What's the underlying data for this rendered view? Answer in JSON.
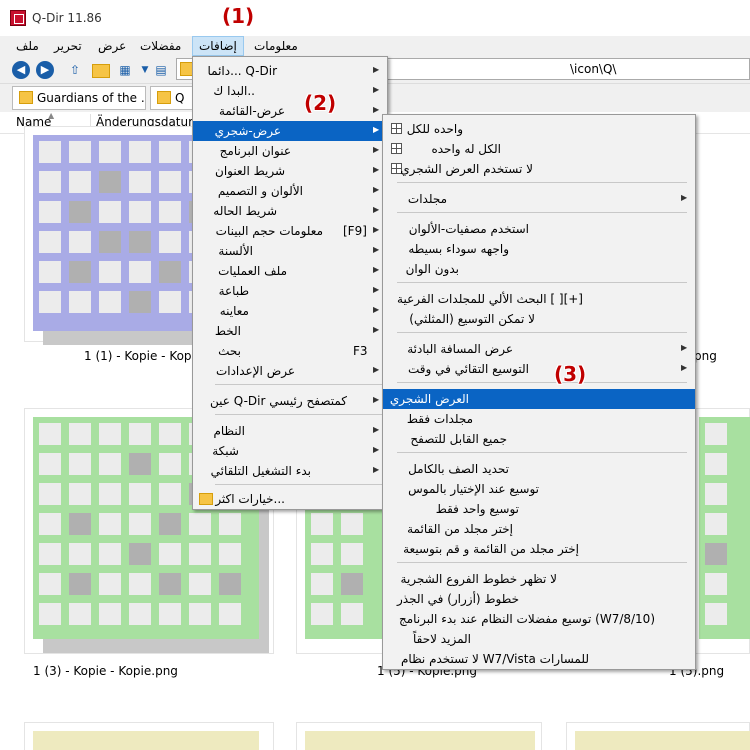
{
  "window": {
    "title": "Q-Dir 11.86"
  },
  "menubar": [
    {
      "label": "ملف"
    },
    {
      "label": "تحرير"
    },
    {
      "label": "عرض"
    },
    {
      "label": "مفضلات"
    },
    {
      "label": "إضافات"
    },
    {
      "label": "معلومات"
    }
  ],
  "address": {
    "path": "\\icon\\Q\\"
  },
  "tabs": [
    {
      "label": "Guardians of the ..."
    },
    {
      "label": "Q"
    }
  ],
  "columns": {
    "name": "Name",
    "modified": "Änderungsdatum"
  },
  "files": [
    {
      "label": "1 (1) - Kopie - Kopie.",
      "color": "#a9abe6"
    },
    {
      "label": "png",
      "color": "#a9abe6"
    },
    {
      "label": "1 (3) - Kopie - Kopie.png",
      "color": "#a8e0a0"
    },
    {
      "label": "1 (5) - Kopie.png",
      "color": "#a8e0a0"
    },
    {
      "label": "1 (5).png",
      "color": "#a8e0a0"
    }
  ],
  "thumbnail_colors": {
    "purple": "#a9abe6",
    "green": "#a8e0a0",
    "yellow": "#eeeabf"
  },
  "extras_menu": {
    "items": [
      {
        "label": "دائما... Q-Dir",
        "has_submenu": true
      },
      {
        "label": "البدا ك..",
        "has_submenu": true
      },
      {
        "label": "عرض-القائمة",
        "has_submenu": true
      },
      {
        "label": "عرض-شجري",
        "has_submenu": true,
        "highlighted": true
      },
      {
        "label": "عنوان البرنامج",
        "has_submenu": true
      },
      {
        "label": "شريط العنوان",
        "has_submenu": true
      },
      {
        "label": "الألوان و التصميم",
        "has_submenu": true
      },
      {
        "label": "شريط الحاله",
        "has_submenu": true
      },
      {
        "label": "معلومات حجم البينات",
        "shortcut": "[F9]",
        "has_submenu": true
      },
      {
        "label": "الألسنة",
        "has_submenu": true
      },
      {
        "label": "ملف العمليات",
        "has_submenu": true
      },
      {
        "label": "طباعة",
        "has_submenu": true
      },
      {
        "label": "معاينه",
        "has_submenu": true
      },
      {
        "label": "الخط",
        "has_submenu": true
      },
      {
        "label": "بحث",
        "shortcut": "F3",
        "has_submenu": true
      },
      {
        "label": "عرض الإعدادات",
        "has_submenu": true
      },
      {
        "label": "عين Q-Dir كمتصفح رئيسي",
        "has_submenu": true
      },
      {
        "label": "النظام",
        "has_submenu": true
      },
      {
        "label": "شبكة",
        "has_submenu": true
      },
      {
        "label": "بدء التشغيل التلقائي",
        "has_submenu": true
      },
      {
        "label": "خيارات اكثر...",
        "has_submenu": false
      }
    ]
  },
  "treeview_menu": {
    "items": [
      {
        "label": "واحده للكل"
      },
      {
        "label": "الكل له واحده"
      },
      {
        "label": "لا تستخدم العرض الشجري"
      },
      {
        "label": "مجلدات",
        "has_submenu": true
      },
      {
        "label": "استخدم مصفيات-الألوان"
      },
      {
        "label": "واجهه سوداء بسيطه"
      },
      {
        "label": "بدون الوان"
      },
      {
        "label": "البحث الألي للمجلدات الفرعية [ ][+]"
      },
      {
        "label": "لا تمكن التوسيع (المثلثي)"
      },
      {
        "label": "عرض المسافة البادئة",
        "has_submenu": true
      },
      {
        "label": "التوسيع التقائي في وقت",
        "has_submenu": true
      },
      {
        "label": "العرض الشجري",
        "highlighted": true
      },
      {
        "label": "مجلدات فقط"
      },
      {
        "label": "جميع القابل للتصفح"
      },
      {
        "label": "تحديد الصف بالكامل"
      },
      {
        "label": "توسيع عند الإختيار بالموس"
      },
      {
        "label": "توسيع واحد فقط"
      },
      {
        "label": "إختر مجلد من القائمة"
      },
      {
        "label": "إختر مجلد من القائمة و قم بتوسيعة"
      },
      {
        "label": "لا تظهر خطوط الفروع الشجرية"
      },
      {
        "label": "خطوط (أزرار) في الجذر"
      },
      {
        "label": "توسيع مفضلات النظام عند بدء البرنامج (W7/8/10)"
      },
      {
        "label": "المزيد لاحقاً"
      },
      {
        "label": "لا تستخدم نظام W7/Vista للمسارات"
      }
    ]
  },
  "callouts": [
    "(1)",
    "(2)",
    "(3)"
  ],
  "colors": {
    "highlight": "#0a64c4",
    "callout": "#c00000",
    "menu_bg": "#f2f2f2"
  }
}
